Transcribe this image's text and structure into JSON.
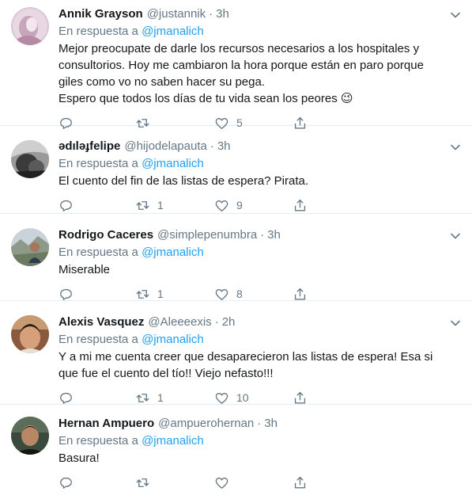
{
  "reply_prefix": "En respuesta a",
  "colors": {
    "text": "#14171a",
    "secondary": "#657786",
    "link": "#1da1f2",
    "divider": "#e6ecf0"
  },
  "tweets": [
    {
      "name": "Annik Grayson",
      "handle": "@justannik",
      "time": "3h",
      "reply_to": "@jmanalich",
      "lines": [
        "Mejor preocupate de darle los recursos necesarios a los hospitales y",
        "consultorios. Hoy me cambiaron la hora porque están en paro porque",
        "giles como vo no saben hacer su pega.",
        "Espero que todos los días de tu vida sean los peores 😉"
      ],
      "replies": "",
      "retweets": "",
      "likes": "5"
    },
    {
      "name": "ədıləɟfelipe",
      "handle": "@hijodelapauta",
      "time": "3h",
      "reply_to": "@jmanalich",
      "lines": [
        "El cuento del fin de las listas de espera? Pirata."
      ],
      "replies": "",
      "retweets": "1",
      "likes": "9"
    },
    {
      "name": "Rodrigo Caceres",
      "handle": "@simplepenumbra",
      "time": "3h",
      "reply_to": "@jmanalich",
      "lines": [
        "Miserable"
      ],
      "replies": "",
      "retweets": "1",
      "likes": "8"
    },
    {
      "name": "Alexis Vasquez",
      "handle": "@Aleeeexis",
      "time": "2h",
      "reply_to": "@jmanalich",
      "lines": [
        "Y a mi me cuenta creer que desaparecieron las listas de espera! Esa si",
        "que fue el cuento del tío!! Viejo nefasto!!!"
      ],
      "replies": "",
      "retweets": "1",
      "likes": "10"
    },
    {
      "name": "Hernan Ampuero",
      "handle": "@ampuerohernan",
      "time": "3h",
      "reply_to": "@jmanalich",
      "lines": [
        "Basura!"
      ],
      "replies": "",
      "retweets": "",
      "likes": ""
    }
  ]
}
